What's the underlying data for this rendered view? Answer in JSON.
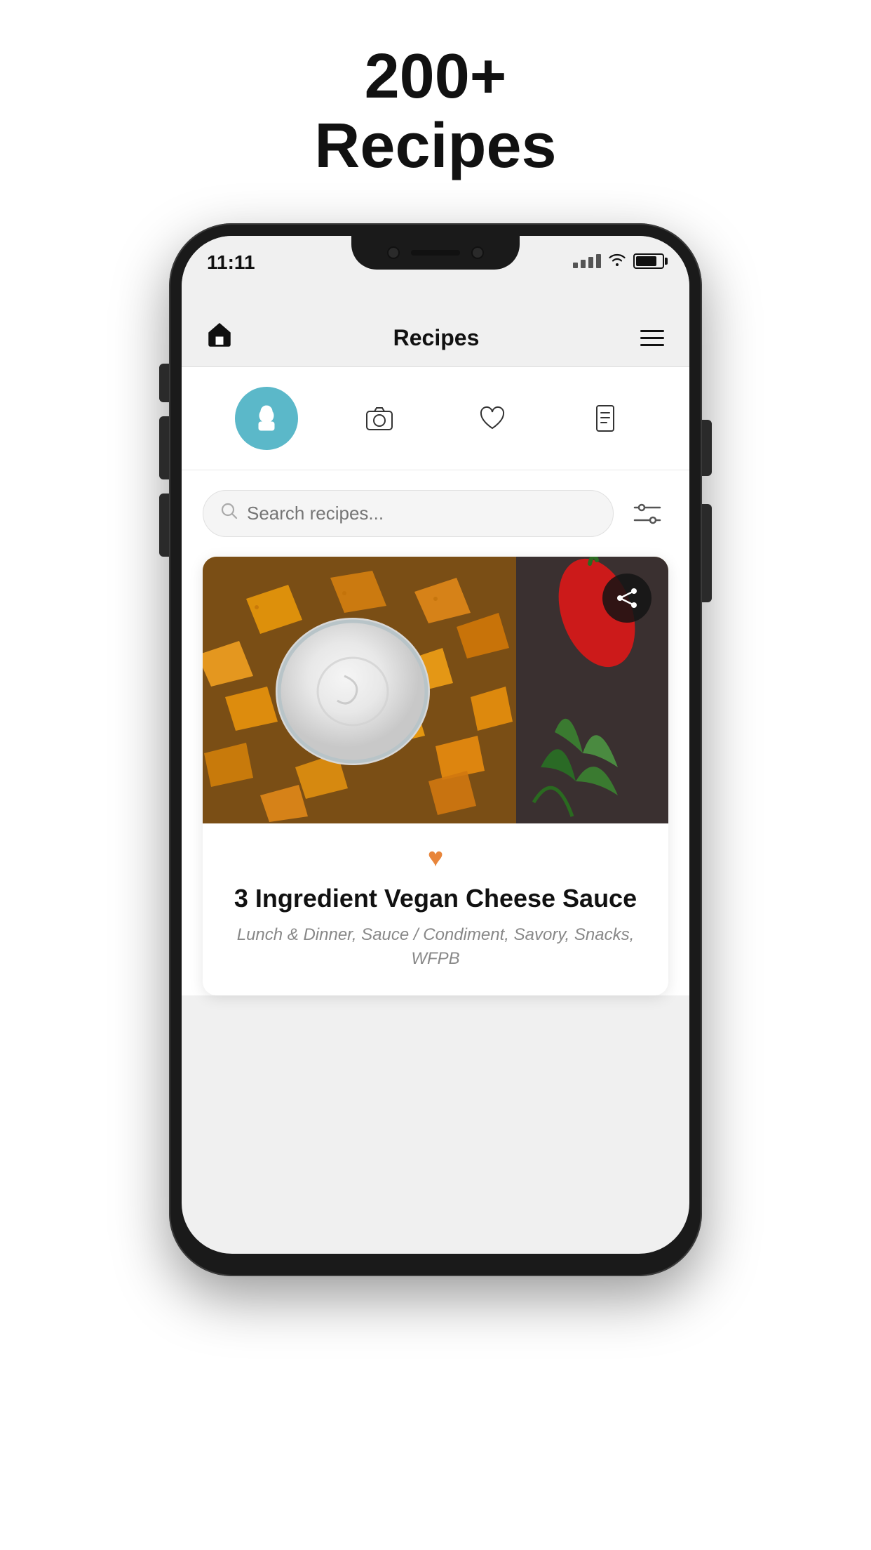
{
  "page": {
    "header": {
      "line1": "200+",
      "line2": "Recipes"
    }
  },
  "phone": {
    "status": {
      "time": "11:11"
    },
    "nav": {
      "title": "Recipes"
    },
    "icons": [
      {
        "name": "chef-hat",
        "active": true
      },
      {
        "name": "camera",
        "active": false
      },
      {
        "name": "heart",
        "active": false
      },
      {
        "name": "document",
        "active": false
      }
    ],
    "search": {
      "placeholder": "Search recipes..."
    },
    "recipe": {
      "title": "3 Ingredient Vegan Cheese Sauce",
      "tags": "Lunch & Dinner, Sauce / Condiment, Savory, Snacks, WFPB"
    }
  }
}
